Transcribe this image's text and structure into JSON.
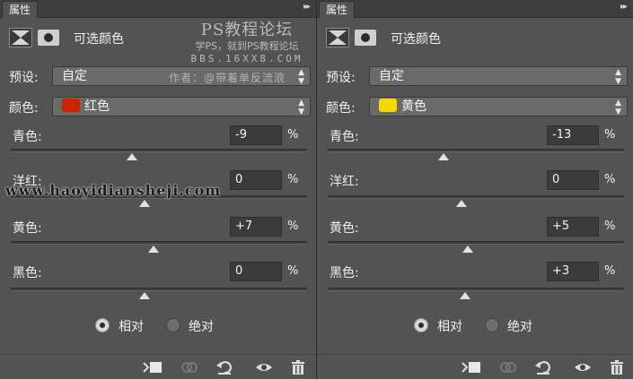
{
  "watermark": {
    "site_title": "PS教程论坛",
    "site_sub": "学PS，就到PS教程论坛",
    "bbs": "BBS.16XX8.COM",
    "author": "作者：@带着单反流浪",
    "url": "www.haoyidiansheji.com"
  },
  "panels": [
    {
      "tab_label": "属性",
      "menu_glyph": "▸▸",
      "adjustment_title": "可选颜色",
      "preset_label": "预设:",
      "preset_value": "自定",
      "color_label": "颜色:",
      "color_value": "红色",
      "color_swatch": "#cc2200",
      "sliders": [
        {
          "label": "青色:",
          "value": "-9",
          "level_pct": -9
        },
        {
          "label": "洋红:",
          "value": "0",
          "level_pct": 0
        },
        {
          "label": "黄色:",
          "value": "+7",
          "level_pct": 7
        },
        {
          "label": "黑色:",
          "value": "0",
          "level_pct": 0
        }
      ],
      "percent_sign": "%",
      "radio_relative": "相对",
      "radio_absolute": "绝对",
      "radio_selected": "relative"
    },
    {
      "tab_label": "属性",
      "menu_glyph": "▸▸",
      "adjustment_title": "可选颜色",
      "preset_label": "预设:",
      "preset_value": "自定",
      "color_label": "颜色:",
      "color_value": "黄色",
      "color_swatch": "#f5d800",
      "sliders": [
        {
          "label": "青色:",
          "value": "-13",
          "level_pct": -13
        },
        {
          "label": "洋红:",
          "value": "0",
          "level_pct": 0
        },
        {
          "label": "黄色:",
          "value": "+5",
          "level_pct": 5
        },
        {
          "label": "黑色:",
          "value": "+3",
          "level_pct": 3
        }
      ],
      "percent_sign": "%",
      "radio_relative": "相对",
      "radio_absolute": "绝对",
      "radio_selected": "relative"
    }
  ],
  "icons": {
    "clip_to_layer": "clip-to-layer-icon",
    "view_previous": "view-previous-state-icon",
    "reset": "reset-icon",
    "visibility": "eye-icon",
    "delete": "trash-icon"
  }
}
